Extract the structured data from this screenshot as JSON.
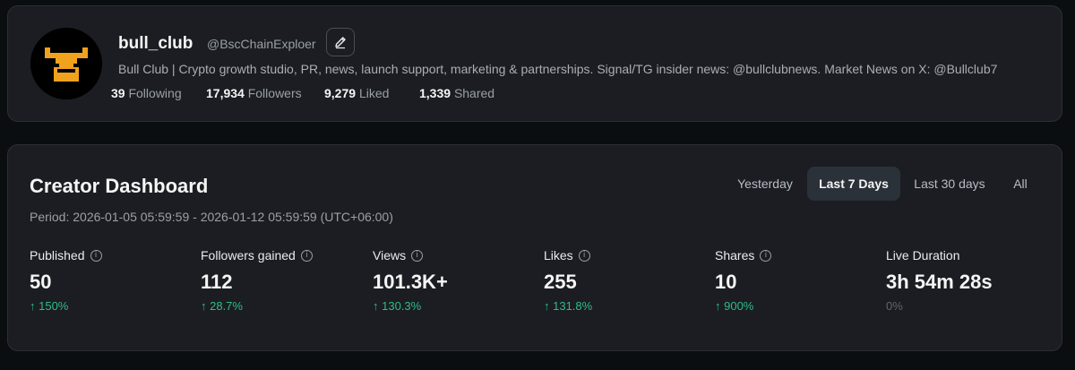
{
  "profile": {
    "name": "bull_club",
    "handle": "@BscChainExploer",
    "bio": "Bull Club | Crypto growth studio, PR, news, launch support, marketing & partnerships. Signal/TG insider news: @bullclubnews. Market News on X: @Bullclub7",
    "stats": [
      {
        "value": "39",
        "label": "Following"
      },
      {
        "value": "17,934",
        "label": "Followers"
      },
      {
        "value": "9,279",
        "label": "Liked"
      },
      {
        "value": "1,339",
        "label": "Shared"
      }
    ],
    "avatar_colors": {
      "background": "#000000",
      "logo": "#f0a21d"
    }
  },
  "dashboard": {
    "title": "Creator Dashboard",
    "period": "Period: 2026-01-05 05:59:59 - 2026-01-12 05:59:59 (UTC+06:00)",
    "tabs": [
      {
        "label": "Yesterday",
        "active": false
      },
      {
        "label": "Last 7 Days",
        "active": true
      },
      {
        "label": "Last 30 days",
        "active": false
      },
      {
        "label": "All",
        "active": false
      }
    ],
    "metrics": [
      {
        "label": "Published",
        "value": "50",
        "change": "↑ 150%",
        "info": true
      },
      {
        "label": "Followers gained",
        "value": "112",
        "change": "↑ 28.7%",
        "info": true
      },
      {
        "label": "Views",
        "value": "101.3K+",
        "change": "↑ 130.3%",
        "info": true
      },
      {
        "label": "Likes",
        "value": "255",
        "change": "↑ 131.8%",
        "info": true
      },
      {
        "label": "Shares",
        "value": "10",
        "change": "↑ 900%",
        "info": true
      },
      {
        "label": "Live Duration",
        "value": "3h 54m 28s",
        "change": "0%",
        "info": false
      }
    ]
  },
  "colors": {
    "positive": "#2ebd85",
    "muted": "#5e6673",
    "card": "#1b1d22",
    "page": "#0b0e11"
  }
}
